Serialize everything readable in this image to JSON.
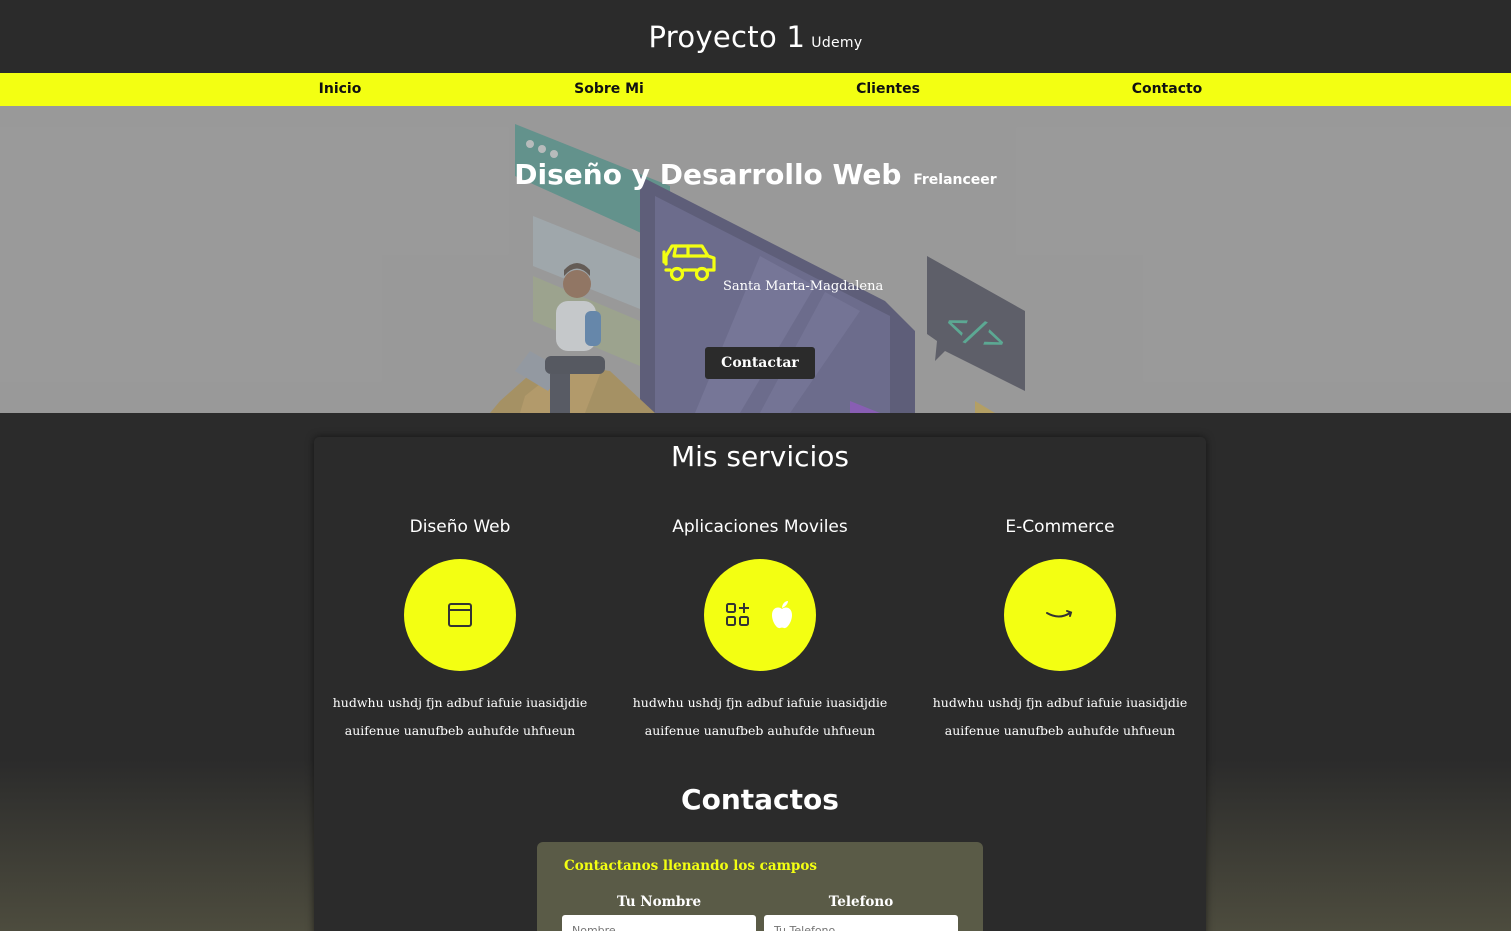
{
  "header": {
    "title": "Proyecto 1",
    "subtitle": "Udemy"
  },
  "nav": {
    "items": [
      "Inicio",
      "Sobre Mi",
      "Clientes",
      "Contacto"
    ]
  },
  "hero": {
    "title": "Diseño y Desarrollo Web",
    "subtitle": "Frelanceer",
    "location": "Santa Marta-Magdalena",
    "button_label": "Contactar",
    "car_icon": "car-icon"
  },
  "services": {
    "title": "Mis servicios",
    "items": [
      {
        "name": "Diseño Web",
        "icon": "browser-window-icon",
        "description": "hudwhu ushdj fjn adbuf iafuie iuasidjdie auifenue uanufbeb auhufde uhfueun"
      },
      {
        "name": "Aplicaciones Moviles",
        "icon": "apps-and-apple-icon",
        "description": "hudwhu ushdj fjn adbuf iafuie iuasidjdie auifenue uanufbeb auhufde uhfueun"
      },
      {
        "name": "E-Commerce",
        "icon": "amazon-smile-icon",
        "description": "hudwhu ushdj fjn adbuf iafuie iuasidjdie auifenue uanufbeb auhufde uhfueun"
      }
    ]
  },
  "contacts": {
    "title": "Contactos",
    "form_heading": "Contactanos llenando los campos",
    "name_label": "Tu Nombre",
    "name_placeholder": "Nombre",
    "phone_label": "Telefono",
    "phone_placeholder": "Tu Telefono"
  },
  "colors": {
    "accent": "#f3ff12",
    "background": "#2b2b2b",
    "hero_overlay": "#9a9a9a",
    "form_bg": "#5a5b47"
  }
}
